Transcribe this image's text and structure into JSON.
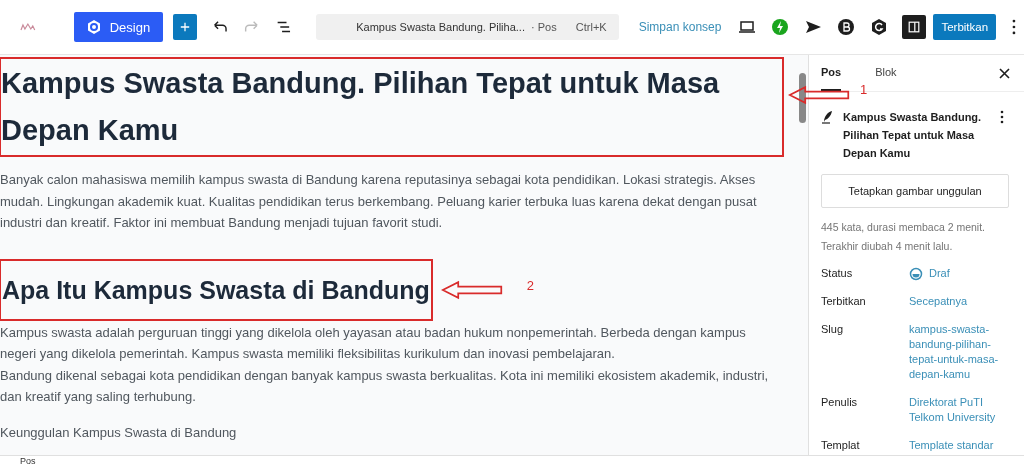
{
  "toolbar": {
    "design_button": "Design",
    "command_bar": {
      "title": "Kampus Swasta Bandung. Piliha...",
      "type": "· Pos",
      "shortcut": "Ctrl+K"
    },
    "save_draft": "Simpan konsep",
    "sidebar_toggle": {
      "on": true
    },
    "publish_button": "Terbitkan"
  },
  "editor": {
    "blocks": [
      {
        "kind": "title",
        "text": "Kampus Swasta Bandung. Pilihan Tepat untuk Masa Depan Kamu",
        "annotation": "1"
      },
      {
        "kind": "paragraph",
        "text": "Banyak calon mahasiswa memilih kampus swasta di Bandung karena reputasinya sebagai kota pendidikan. Lokasi strategis. Akses mudah. Lingkungan akademik kuat. Kualitas pendidikan terus berkembang. Peluang karier terbuka luas karena dekat dengan pusat industri dan kreatif. Faktor ini membuat Bandung menjadi tujuan favorit studi."
      },
      {
        "kind": "heading",
        "text": "Apa Itu Kampus Swasta di Bandung",
        "annotation": "2"
      },
      {
        "kind": "paragraph",
        "text": "Kampus swasta adalah perguruan tinggi yang dikelola oleh yayasan atau badan hukum nonpemerintah. Berbeda dengan kampus negeri yang dikelola pemerintah. Kampus swasta memiliki fleksibilitas kurikulum dan inovasi pembelajaran."
      },
      {
        "kind": "paragraph",
        "text": "Bandung dikenal sebagai kota pendidikan dengan banyak kampus swasta berkualitas. Kota ini memiliki ekosistem akademik, industri, dan kreatif yang saling terhubung."
      },
      {
        "kind": "line",
        "text": "Keunggulan Kampus Swasta di Bandung"
      }
    ]
  },
  "sidebar": {
    "tabs": [
      {
        "label": "Pos",
        "selected": true
      },
      {
        "label": "Blok",
        "selected": false
      }
    ],
    "post_title": "Kampus Swasta Bandung. Pilihan Tepat untuk Masa Depan Kamu",
    "featured_image_button": "Tetapkan gambar unggulan",
    "stats": [
      "445 kata, durasi membaca 2 menit.",
      "Terakhir diubah 4 menit lalu."
    ],
    "rows": [
      {
        "label": "Status",
        "value": "Draf",
        "kind": "status"
      },
      {
        "label": "Terbitkan",
        "value": "Secepatnya",
        "kind": "link"
      },
      {
        "label": "Slug",
        "value": "kampus-swasta-bandung-pilihan-tepat-untuk-masa-depan-kamu",
        "kind": "link"
      },
      {
        "label": "Penulis",
        "value": "Direktorat PuTI Telkom University",
        "kind": "link"
      },
      {
        "label": "Templat",
        "value": "Template standar",
        "kind": "link"
      }
    ]
  },
  "breadcrumb": "Pos"
}
